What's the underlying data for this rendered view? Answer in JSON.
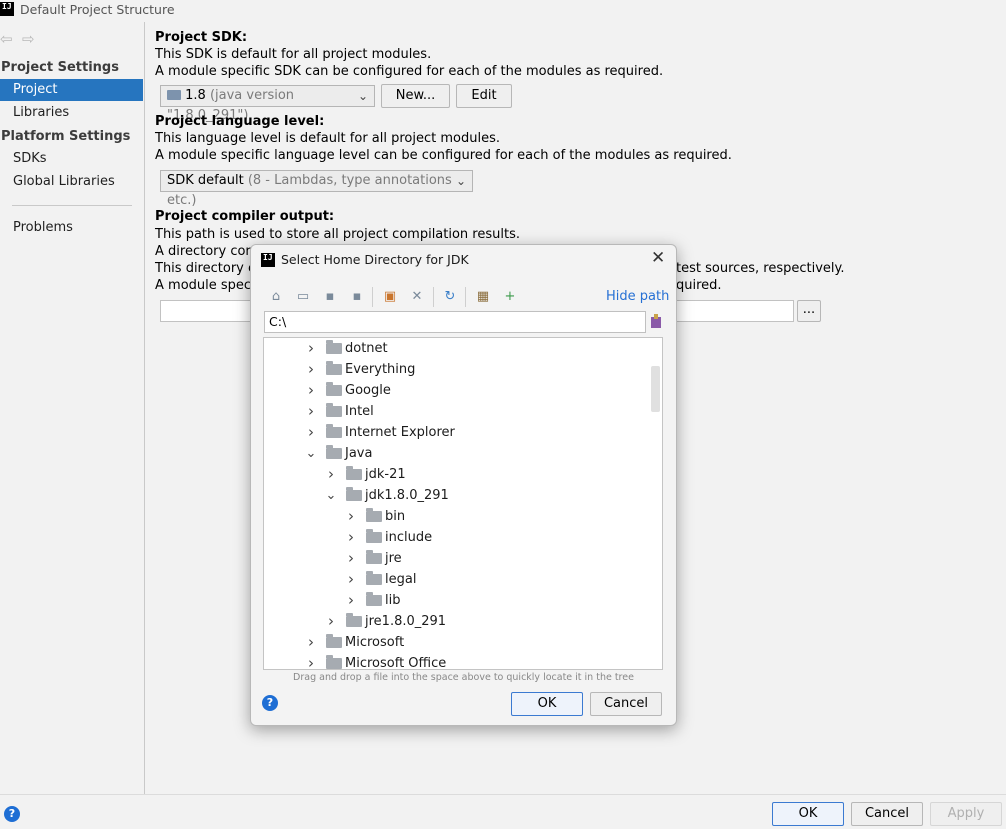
{
  "window": {
    "title": "Default Project Structure",
    "logo": "IJ"
  },
  "sidebar": {
    "sections": [
      {
        "heading": "Project Settings",
        "items": [
          "Project",
          "Libraries"
        ]
      },
      {
        "heading": "Platform Settings",
        "items": [
          "SDKs",
          "Global Libraries"
        ]
      }
    ],
    "selected_item": "Project",
    "problems_label": "Problems"
  },
  "main": {
    "sdk": {
      "heading": "Project SDK:",
      "line1": "This SDK is default for all project modules.",
      "line2": "A module specific SDK can be configured for each of the modules as required.",
      "combo_value": "1.8",
      "combo_detail": "(java version \"1.8.0_291\")",
      "new_label": "New...",
      "edit_label": "Edit"
    },
    "language": {
      "heading": "Project language level:",
      "line1": "This language level is default for all project modules.",
      "line2": "A module specific language level can be configured for each of the modules as required.",
      "combo_value": "SDK default",
      "combo_detail": "(8 - Lambdas, type annotations etc.)"
    },
    "compiler": {
      "heading": "Project compiler output:",
      "line1": "This path is used to store all project compilation results.",
      "line2_visible": "A directory corre",
      "line3_visible": "This directory co",
      "line3_right": "test sources, respectively.",
      "line4_visible": "A module specifi",
      "line4_right": "quired.",
      "path_value": "",
      "browse_label": "..."
    }
  },
  "bottom": {
    "ok_label": "OK",
    "cancel_label": "Cancel",
    "apply_label": "Apply"
  },
  "dialog": {
    "title": "Select Home Directory for JDK",
    "logo": "IJ",
    "hide_path_label": "Hide path",
    "path_value": "C:\\",
    "hint": "Drag and drop a file into the space above to quickly locate it in the tree",
    "ok_label": "OK",
    "cancel_label": "Cancel",
    "toolbar_icons": [
      "home-icon",
      "desktop-icon",
      "project-folder-icon",
      "module-folder-icon",
      "new-folder-icon",
      "delete-icon",
      "refresh-icon",
      "show-hidden-icon",
      "add-icon"
    ],
    "tree": [
      {
        "label": "dotnet",
        "level": 0,
        "expanded": false
      },
      {
        "label": "Everything",
        "level": 0,
        "expanded": false
      },
      {
        "label": "Google",
        "level": 0,
        "expanded": false
      },
      {
        "label": "Intel",
        "level": 0,
        "expanded": false
      },
      {
        "label": "Internet Explorer",
        "level": 0,
        "expanded": false
      },
      {
        "label": "Java",
        "level": 0,
        "expanded": true
      },
      {
        "label": "jdk-21",
        "level": 1,
        "expanded": false
      },
      {
        "label": "jdk1.8.0_291",
        "level": 1,
        "expanded": true
      },
      {
        "label": "bin",
        "level": 2,
        "expanded": false
      },
      {
        "label": "include",
        "level": 2,
        "expanded": false
      },
      {
        "label": "jre",
        "level": 2,
        "expanded": false
      },
      {
        "label": "legal",
        "level": 2,
        "expanded": false
      },
      {
        "label": "lib",
        "level": 2,
        "expanded": false
      },
      {
        "label": "jre1.8.0_291",
        "level": 1,
        "expanded": false
      },
      {
        "label": "Microsoft",
        "level": 0,
        "expanded": false
      },
      {
        "label": "Microsoft Office",
        "level": 0,
        "expanded": false
      }
    ]
  }
}
